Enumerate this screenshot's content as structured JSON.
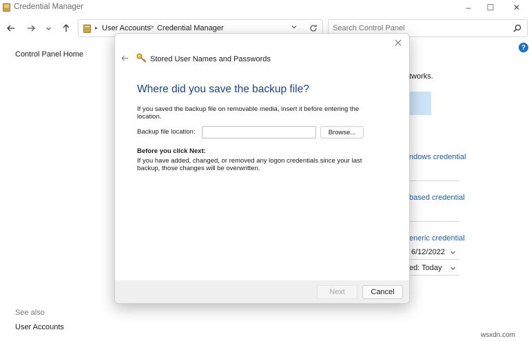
{
  "window": {
    "title": "Credential Manager",
    "controls": {
      "minimize": "–",
      "maximize": "☐",
      "close": "✕"
    }
  },
  "navigation": {
    "back_icon": "arrow-left-icon",
    "forward_icon": "arrow-right-icon",
    "recent_icon": "chevron-down-icon",
    "up_icon": "arrow-up-icon",
    "breadcrumb": [
      "User Accounts",
      "Credential Manager"
    ],
    "breadcrumb_separator": ">",
    "search_placeholder": "Search Control Panel"
  },
  "sidebar": {
    "home_link": "Control Panel Home",
    "see_also_label": "See also",
    "see_also_links": [
      "User Accounts"
    ]
  },
  "background": {
    "text_fragment": "tworks.",
    "links": [
      "ndows credential",
      "based credential",
      "eneric credential"
    ],
    "date_value": "6/12/2022",
    "modified_value": "ed: Today"
  },
  "dialog": {
    "header": "Stored User Names and Passwords",
    "heading": "Where did you save the backup file?",
    "instruction": "If you saved the backup file on removable media, insert it before entering the location.",
    "field_label": "Backup file location:",
    "field_value": "",
    "browse_label": "Browse...",
    "before_next_title": "Before you click Next:",
    "before_next_text": "If you have added, changed, or removed any logon credentials since your last backup, those changes will be overwritten.",
    "next_label": "Next",
    "cancel_label": "Cancel"
  },
  "watermark": "wsxdn.com",
  "colors": {
    "heading_blue": "#1e3f8a",
    "link_blue": "#1f5fa8",
    "help_icon_blue": "#1c6fc9",
    "selection_blue": "#cce4f7",
    "footer_gray": "#f0f0f0"
  }
}
